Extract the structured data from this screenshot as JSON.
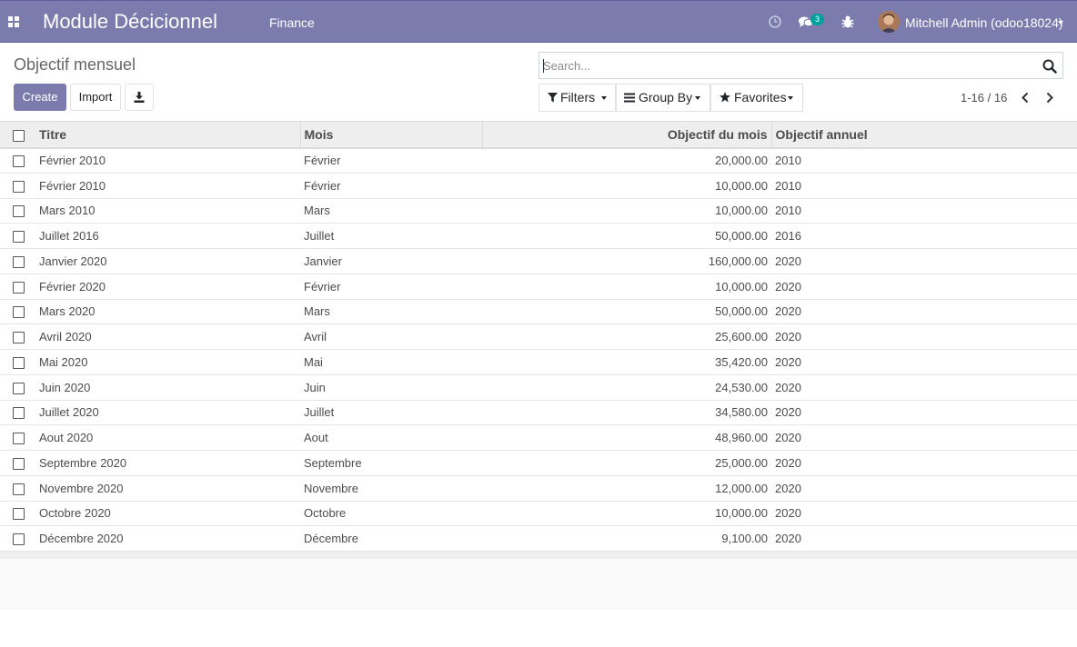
{
  "navbar": {
    "brand": "Module Décicionnel",
    "menu": "Finance",
    "chat_count": "3",
    "user": "Mitchell Admin (odoo18024)",
    "color": "#7c7bad"
  },
  "control_panel": {
    "title": "Objectif mensuel",
    "create_label": "Create",
    "import_label": "Import",
    "search_placeholder": "Search...",
    "filters_label": "Filters",
    "groupby_label": "Group By",
    "favorites_label": "Favorites",
    "pager_text": "1-16 / 16"
  },
  "list": {
    "columns": {
      "titre": "Titre",
      "mois": "Mois",
      "objectif": "Objectif du mois",
      "annuel": "Objectif annuel"
    },
    "rows": [
      {
        "titre": "Février 2010",
        "mois": "Février",
        "objectif": "20,000.00",
        "annuel": "2010"
      },
      {
        "titre": "Février 2010",
        "mois": "Février",
        "objectif": "10,000.00",
        "annuel": "2010"
      },
      {
        "titre": "Mars 2010",
        "mois": "Mars",
        "objectif": "10,000.00",
        "annuel": "2010"
      },
      {
        "titre": "Juillet 2016",
        "mois": "Juillet",
        "objectif": "50,000.00",
        "annuel": "2016"
      },
      {
        "titre": "Janvier 2020",
        "mois": "Janvier",
        "objectif": "160,000.00",
        "annuel": "2020"
      },
      {
        "titre": "Février 2020",
        "mois": "Février",
        "objectif": "10,000.00",
        "annuel": "2020"
      },
      {
        "titre": "Mars 2020",
        "mois": "Mars",
        "objectif": "50,000.00",
        "annuel": "2020"
      },
      {
        "titre": "Avril 2020",
        "mois": "Avril",
        "objectif": "25,600.00",
        "annuel": "2020"
      },
      {
        "titre": "Mai 2020",
        "mois": "Mai",
        "objectif": "35,420.00",
        "annuel": "2020"
      },
      {
        "titre": "Juin 2020",
        "mois": "Juin",
        "objectif": "24,530.00",
        "annuel": "2020"
      },
      {
        "titre": "Juillet 2020",
        "mois": "Juillet",
        "objectif": "34,580.00",
        "annuel": "2020"
      },
      {
        "titre": "Aout 2020",
        "mois": "Aout",
        "objectif": "48,960.00",
        "annuel": "2020"
      },
      {
        "titre": "Septembre 2020",
        "mois": "Septembre",
        "objectif": "25,000.00",
        "annuel": "2020"
      },
      {
        "titre": "Novembre 2020",
        "mois": "Novembre",
        "objectif": "12,000.00",
        "annuel": "2020"
      },
      {
        "titre": "Octobre 2020",
        "mois": "Octobre",
        "objectif": "10,000.00",
        "annuel": "2020"
      },
      {
        "titre": "Décembre 2020",
        "mois": "Décembre",
        "objectif": "9,100.00",
        "annuel": "2020"
      }
    ]
  },
  "icons": {
    "apps": "apps-grid-icon",
    "clock": "clock-icon",
    "chat": "chat-icon",
    "bug": "bug-icon",
    "download": "download-icon",
    "search": "search-icon",
    "filter": "filter-icon",
    "groupby": "bars-icon",
    "favorites": "star-icon"
  }
}
